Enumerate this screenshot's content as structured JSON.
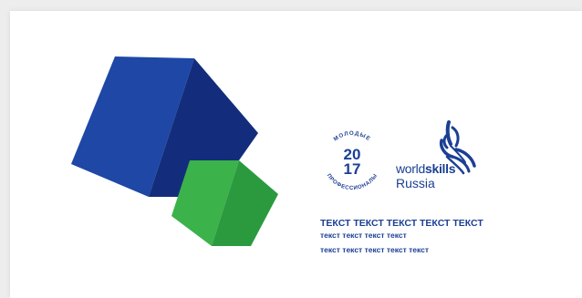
{
  "colors": {
    "background": "#ededed",
    "card": "#ffffff",
    "navy": "#1b3f94",
    "cube_blue_light": "#1e47a6",
    "cube_blue_dark": "#132d7c",
    "cube_green_light": "#3bb24a",
    "cube_green_dark": "#2b9a3f"
  },
  "badge": {
    "top_text": "МОЛОДЫЕ",
    "bottom_text": "ПРОФЕССИОНАЛЫ",
    "year_top": "20",
    "year_bottom": "17"
  },
  "worldskills": {
    "word_light": "world",
    "word_bold": "skills",
    "country": "Russia"
  },
  "text_block": {
    "line1": "ТЕКСТ ТЕКСТ ТЕКСТ ТЕКСТ ТЕКСТ",
    "line2": "текст текст текст текст",
    "line3": "текст текст текст текст текст"
  }
}
